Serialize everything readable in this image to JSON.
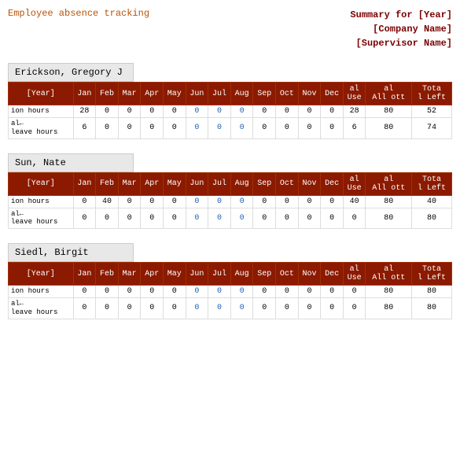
{
  "header": {
    "title": "Employee absence tracking",
    "summary_label": "Summary for [Year]",
    "company": "[Company Name]",
    "supervisor": "[Supervisor Name]"
  },
  "columns": {
    "header": [
      "[Year]",
      "Jan",
      "Feb",
      "Mar",
      "Apr",
      "May",
      "Jun",
      "Jul",
      "Aug",
      "Sep",
      "Oct",
      "Nov",
      "Dec",
      "al Use",
      "al All ott",
      "Tota l Left"
    ]
  },
  "employees": [
    {
      "name": "Erickson, Gregory J",
      "rows": [
        {
          "label": "ion hours",
          "values": [
            "28",
            "0",
            "0",
            "0",
            "0",
            "0",
            "0",
            "0",
            "0",
            "0",
            "0",
            "0"
          ],
          "sub_label": "al←",
          "total_use": "28",
          "total_all": "80",
          "total_left": "52"
        },
        {
          "label": "al←\nleave hours",
          "values": [
            "6",
            "0",
            "0",
            "0",
            "0",
            "0",
            "0",
            "0",
            "0",
            "0",
            "0",
            "0"
          ],
          "total_use": "6",
          "total_all": "80",
          "total_left": "74"
        }
      ]
    },
    {
      "name": "Sun, Nate",
      "rows": [
        {
          "label": "ion hours",
          "values": [
            "0",
            "40",
            "0",
            "0",
            "0",
            "0",
            "0",
            "0",
            "0",
            "0",
            "0",
            "0"
          ],
          "total_use": "40",
          "total_all": "80",
          "total_left": "40"
        },
        {
          "label": "al←\nleave hours",
          "values": [
            "0",
            "0",
            "0",
            "0",
            "0",
            "0",
            "0",
            "0",
            "0",
            "0",
            "0",
            "0"
          ],
          "total_use": "0",
          "total_all": "80",
          "total_left": "80"
        }
      ]
    },
    {
      "name": "Siedl, Birgit",
      "rows": [
        {
          "label": "ion hours",
          "values": [
            "0",
            "0",
            "0",
            "0",
            "0",
            "0",
            "0",
            "0",
            "0",
            "0",
            "0",
            "0"
          ],
          "total_use": "0",
          "total_all": "80",
          "total_left": "80"
        },
        {
          "label": "al←\nleave hours",
          "values": [
            "0",
            "0",
            "0",
            "0",
            "0",
            "0",
            "0",
            "0",
            "0",
            "0",
            "0",
            "0"
          ],
          "total_use": "0",
          "total_all": "80",
          "total_left": "80"
        }
      ]
    }
  ]
}
